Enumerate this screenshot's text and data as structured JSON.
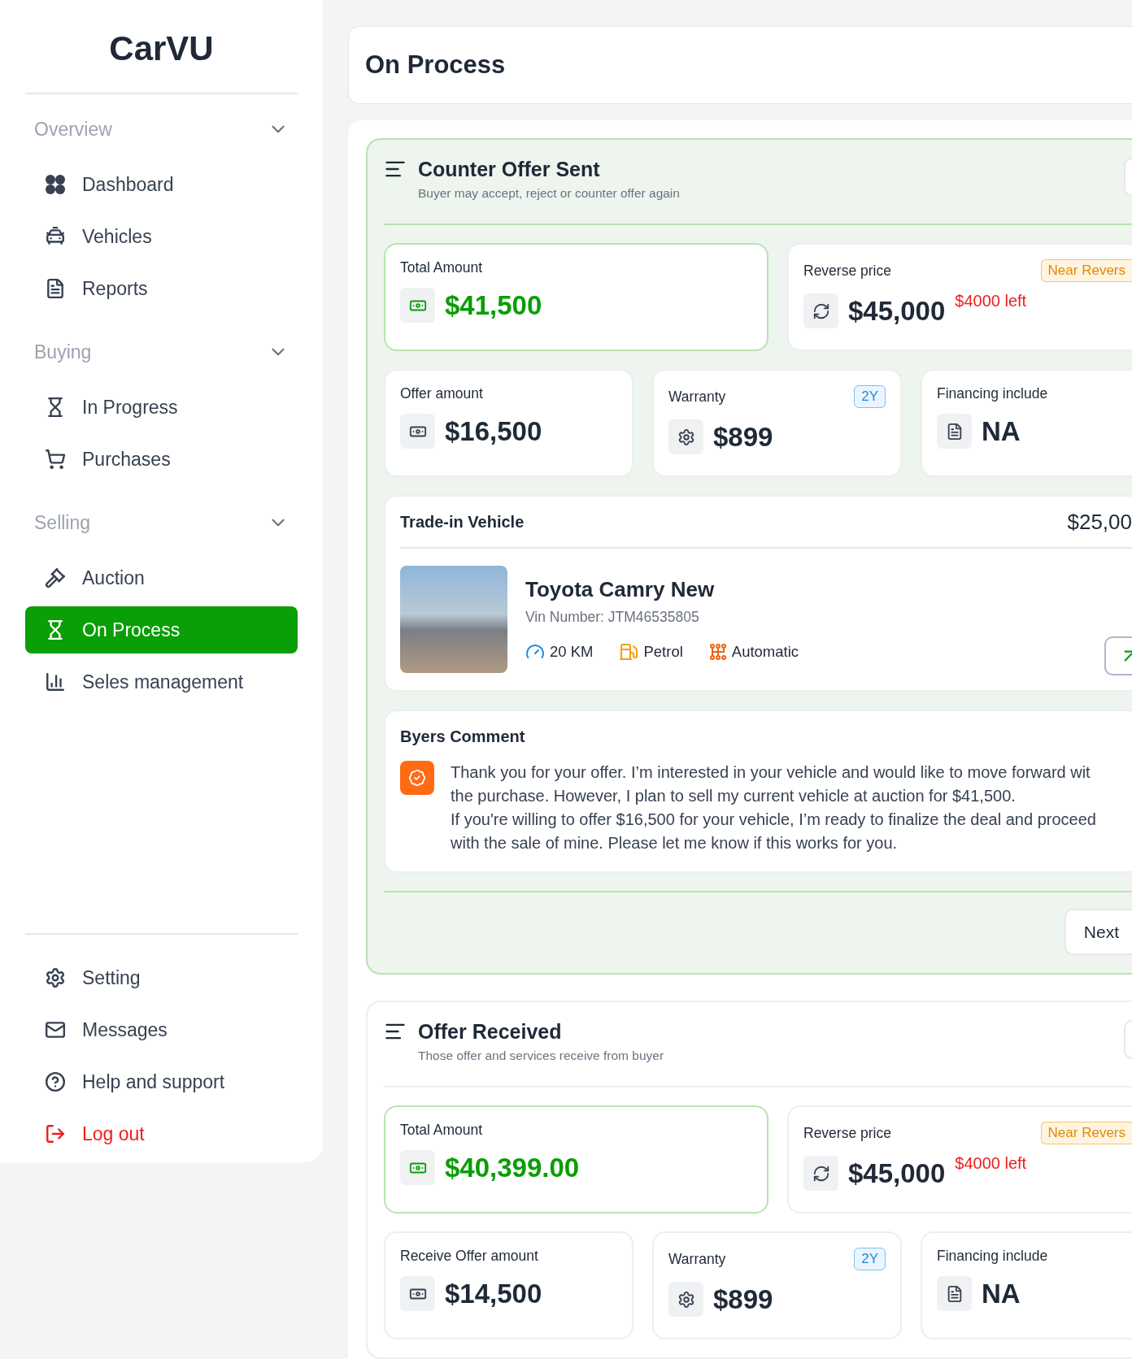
{
  "brand": "CarVU",
  "sidebar": {
    "groups": [
      {
        "label": "Overview",
        "expanded": true,
        "items": [
          {
            "label": "Dashboard",
            "selected": false
          },
          {
            "label": "Vehicles",
            "selected": false
          },
          {
            "label": "Reports",
            "selected": false
          }
        ]
      },
      {
        "label": "Buying",
        "expanded": true,
        "items": [
          {
            "label": "In Progress",
            "selected": false
          },
          {
            "label": "Purchases",
            "selected": false
          }
        ]
      },
      {
        "label": "Selling",
        "expanded": true,
        "items": [
          {
            "label": "Auction",
            "selected": false
          },
          {
            "label": "On Process",
            "selected": true
          },
          {
            "label": "Seles management",
            "selected": false
          }
        ]
      }
    ],
    "bottom_items": [
      {
        "label": "Setting",
        "kind": "normal"
      },
      {
        "label": "Messages",
        "kind": "normal"
      },
      {
        "label": "Help and support",
        "kind": "normal"
      },
      {
        "label": "Log out",
        "kind": "danger"
      }
    ]
  },
  "page_title": "On Process",
  "sections": [
    {
      "title": "Counter Offer Sent",
      "subtitle": "Buyer may accept, reject or counter offer again",
      "highlighted": true,
      "total": {
        "label": "Total Amount",
        "value": "$41,500"
      },
      "reserve": {
        "label": "Reverse price",
        "value": "$45,000",
        "note": "$4000 left",
        "badge": "Near Revers"
      },
      "stats": [
        {
          "label": "Offer amount",
          "value": "$16,500",
          "kind": "cash"
        },
        {
          "label": "Warranty",
          "value": "$899",
          "kind": "warranty",
          "badge": "2Y"
        },
        {
          "label": "Financing include",
          "value": "NA",
          "kind": "financing"
        }
      ],
      "trade_in": {
        "title": "Trade-in Vehicle",
        "price": "$25,00",
        "name": "Toyota Camry New",
        "vin": "Vin Number: JTM46535805",
        "specs": [
          {
            "kind": "mileage",
            "text": "20 KM"
          },
          {
            "kind": "fuel",
            "text": "Petrol"
          },
          {
            "kind": "transmission",
            "text": "Automatic"
          }
        ]
      },
      "comment": {
        "title": "Byers Comment",
        "lines": [
          "Thank you for your offer. I’m interested in your vehicle and would like to move forward wit",
          "the purchase. However, I plan to sell my current vehicle at auction for $41,500.",
          "If you're willing to offer $16,500 for your vehicle, I’m ready to finalize the deal and proceed",
          "with the sale of mine. Please let me know if this works for you."
        ]
      },
      "next_button": "Next"
    },
    {
      "title": "Offer Received",
      "subtitle": "Those offer and services receive from buyer",
      "highlighted": false,
      "total": {
        "label": "Total Amount",
        "value": "$40,399.00"
      },
      "reserve": {
        "label": "Reverse price",
        "value": "$45,000",
        "note": "$4000 left",
        "badge": "Near Revers"
      },
      "stats": [
        {
          "label": "Receive Offer amount",
          "value": "$14,500",
          "kind": "cash"
        },
        {
          "label": "Warranty",
          "value": "$899",
          "kind": "warranty",
          "badge": "2Y"
        },
        {
          "label": "Financing include",
          "value": "NA",
          "kind": "financing"
        }
      ]
    }
  ]
}
